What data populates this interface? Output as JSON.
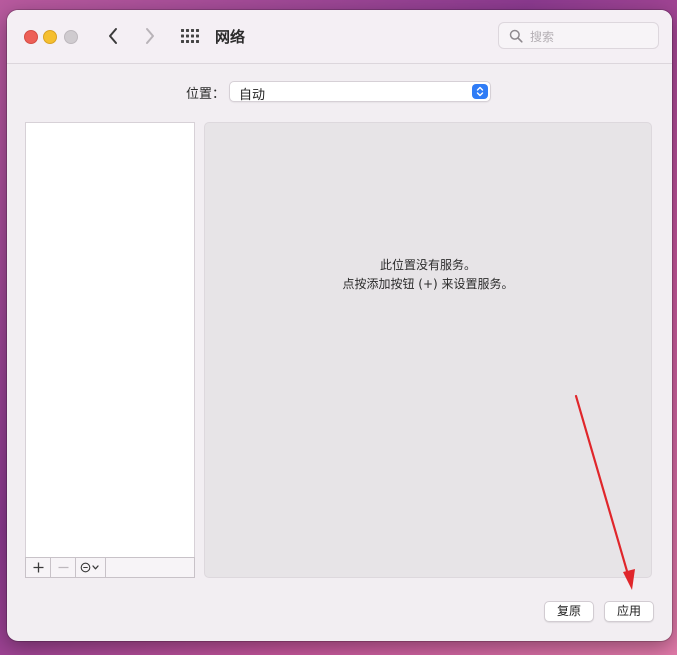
{
  "window": {
    "title": "网络",
    "search_placeholder": "搜索"
  },
  "location": {
    "label": "位置：",
    "selected": "自动"
  },
  "detail": {
    "line1": "此位置没有服务。",
    "line2": "点按添加按钮 (+) 来设置服务。"
  },
  "buttons": {
    "revert": "复原",
    "apply": "应用"
  },
  "colors": {
    "accent": "#2f7cf6",
    "close": "#ed5f57",
    "minimize": "#f5bf2f",
    "annotation_arrow": "#e0262b"
  },
  "icons": [
    "search-icon",
    "back-chevron-icon",
    "forward-chevron-icon",
    "grid-icon",
    "plus-icon",
    "minus-icon",
    "action-menu-icon",
    "up-down-chevron-icon"
  ]
}
